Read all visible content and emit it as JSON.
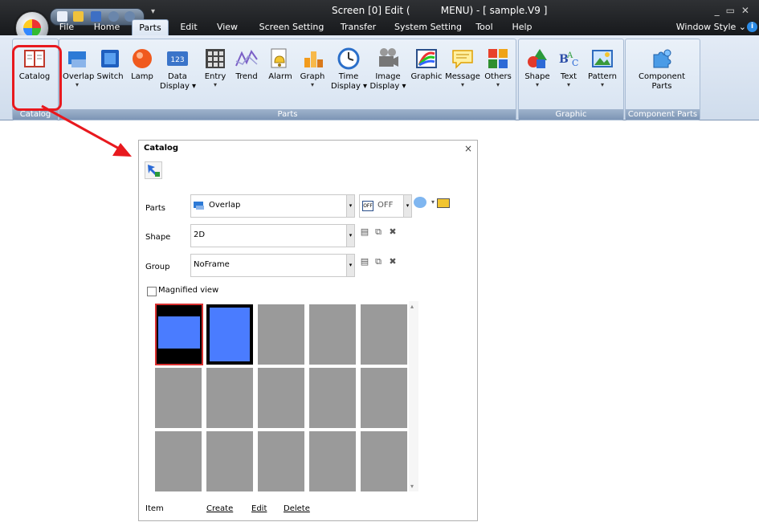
{
  "window": {
    "title_left": "Screen [0] Edit (",
    "title_right": "MENU) - [ sample.V9 ]",
    "window_style": "Window Style",
    "help": "i"
  },
  "menu_tabs": [
    "File",
    "Home",
    "Parts",
    "Edit",
    "View",
    "Screen Setting",
    "Transfer",
    "System Setting",
    "Tool",
    "Help"
  ],
  "ribbon": {
    "groups": {
      "catalog": "Catalog",
      "parts": "Parts",
      "graphic": "Graphic",
      "component": "Component Parts"
    },
    "buttons": {
      "catalog": "Catalog",
      "overlap": "Overlap",
      "switch": "Switch",
      "lamp": "Lamp",
      "data_display_1": "Data",
      "data_display_2": "Display",
      "data_display_icon": "123",
      "entry": "Entry",
      "trend": "Trend",
      "alarm": "Alarm",
      "graph": "Graph",
      "time_display_1": "Time",
      "time_display_2": "Display",
      "image_display_1": "Image",
      "image_display_2": "Display",
      "graphic": "Graphic",
      "message": "Message",
      "others": "Others",
      "shape": "Shape",
      "text": "Text",
      "pattern": "Pattern",
      "component_1": "Component",
      "component_2": "Parts"
    }
  },
  "panel": {
    "title": "Catalog",
    "close": "×",
    "parts_label": "Parts",
    "parts_value": "Overlap",
    "off_label": "OFF",
    "shape_label": "Shape",
    "shape_value": "2D",
    "group_label": "Group",
    "group_value": "NoFrame",
    "magnified": "Magnified view",
    "item_label": "Item",
    "create": "Create",
    "edit": "Edit",
    "delete": "Delete"
  },
  "colors": {
    "highlight": "#e8191e",
    "tile_blue": "#4a7cff",
    "tile_gray": "#9a9a9a"
  }
}
